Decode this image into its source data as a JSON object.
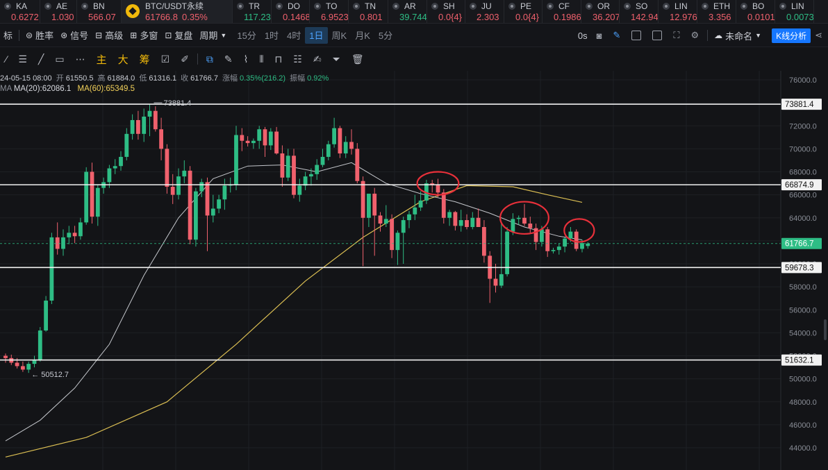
{
  "ticker": [
    {
      "sym": "KA",
      "price": "0.6272",
      "dir": "down"
    },
    {
      "sym": "AE",
      "price": "1.030",
      "dir": "down"
    },
    {
      "sym": "BN",
      "price": "566.07",
      "dir": "down"
    },
    {
      "sym": "BTC/USDT永续",
      "price": "61766.8",
      "change": "0.35%",
      "dir": "down",
      "active": true
    },
    {
      "sym": "TR",
      "price": "117.23",
      "dir": "up"
    },
    {
      "sym": "DO",
      "price": "0.1468",
      "dir": "down"
    },
    {
      "sym": "TO",
      "price": "6.9523",
      "dir": "down"
    },
    {
      "sym": "TN",
      "price": "0.801",
      "dir": "down"
    },
    {
      "sym": "AR",
      "price": "39.744",
      "dir": "up"
    },
    {
      "sym": "SH",
      "price": "0.0{4}",
      "dir": "down"
    },
    {
      "sym": "JU",
      "price": "2.303",
      "dir": "down"
    },
    {
      "sym": "PE",
      "price": "0.0{4}",
      "dir": "down"
    },
    {
      "sym": "CF",
      "price": "0.1986",
      "dir": "down"
    },
    {
      "sym": "OR",
      "price": "36.207",
      "dir": "down"
    },
    {
      "sym": "SO",
      "price": "142.94",
      "dir": "down"
    },
    {
      "sym": "LIN",
      "price": "12.976",
      "dir": "down"
    },
    {
      "sym": "ETH",
      "price": "3.356",
      "dir": "down"
    },
    {
      "sym": "BO",
      "price": "0.0101",
      "dir": "down"
    },
    {
      "sym": "LIN",
      "price": "0.0073",
      "dir": "up"
    }
  ],
  "toolbar1": {
    "left_partial": "标",
    "winrate": "胜率",
    "signal": "信号",
    "advanced": "高级",
    "multiframe": "多窗",
    "replay": "复盘",
    "period": "周期",
    "intervals": [
      "15分",
      "1时",
      "4时",
      "1日",
      "周K",
      "月K",
      "5分"
    ],
    "selected_interval": "1日",
    "delay": "0s",
    "layout_name": "未命名",
    "kline_analysis": "K线分析"
  },
  "toolbar2": {
    "labels": [
      "主",
      "大",
      "筹"
    ]
  },
  "legend": {
    "date": "24-05-15 08:00",
    "open_label": "开",
    "open": "61550.5",
    "high_label": "高",
    "high": "61884.0",
    "low_label": "低",
    "low": "61316.1",
    "close_label": "收",
    "close": "61766.7",
    "chg_label": "涨幅",
    "chg": "0.35%(216.2)",
    "amp_label": "振幅",
    "amp": "0.92%",
    "ma_prefix": "MA",
    "ma20": "MA(20):62086.1",
    "ma60": "MA(60):65349.5"
  },
  "colors": {
    "up": "#2ebd85",
    "down": "#f0616d",
    "ma20": "#d7d9df",
    "ma60": "#f2d15a",
    "bg": "#131417",
    "circle": "#e8303a"
  },
  "chart_data": {
    "type": "candlestick",
    "ylim": [
      43000,
      77000
    ],
    "y_ticks": [
      44000,
      46000,
      48000,
      50000,
      52000,
      54000,
      56000,
      58000,
      60000,
      62000,
      64000,
      66000,
      68000,
      70000,
      72000,
      74000,
      76000
    ],
    "hlines": [
      {
        "value": 73881.4,
        "label": "73881.4"
      },
      {
        "value": 66874.9,
        "label": "66874.9"
      },
      {
        "value": 59678.3,
        "label": "59678.3"
      },
      {
        "value": 51632.1,
        "label": "51632.1"
      }
    ],
    "current_price": {
      "value": 61766.7,
      "label": "61766.7"
    },
    "annotations": [
      {
        "text": "73881.4",
        "kind": "high"
      },
      {
        "text": "50512.7",
        "kind": "low"
      }
    ],
    "candles": [
      [
        52000,
        52200,
        51400,
        51800
      ],
      [
        51800,
        52100,
        51200,
        51400
      ],
      [
        51400,
        51800,
        50900,
        51100
      ],
      [
        51100,
        51500,
        50600,
        50800
      ],
      [
        50800,
        51500,
        50512,
        51300
      ],
      [
        51300,
        52000,
        51000,
        51600
      ],
      [
        51600,
        54500,
        51500,
        54200
      ],
      [
        54200,
        57200,
        54100,
        56800
      ],
      [
        56800,
        62700,
        56500,
        62300
      ],
      [
        62300,
        63600,
        60800,
        61300
      ],
      [
        61300,
        63000,
        60700,
        62300
      ],
      [
        62300,
        63300,
        61700,
        62700
      ],
      [
        62700,
        63300,
        61800,
        62400
      ],
      [
        62400,
        64000,
        62100,
        63600
      ],
      [
        63600,
        68400,
        63400,
        68000
      ],
      [
        68000,
        68800,
        63500,
        64100
      ],
      [
        64100,
        66900,
        63300,
        66600
      ],
      [
        66600,
        67500,
        66100,
        67100
      ],
      [
        67100,
        68600,
        66600,
        68300
      ],
      [
        68300,
        69100,
        67800,
        68500
      ],
      [
        68500,
        69800,
        68100,
        69300
      ],
      [
        69300,
        71800,
        69000,
        71300
      ],
      [
        71300,
        73000,
        70800,
        72500
      ],
      [
        72500,
        73300,
        70800,
        71300
      ],
      [
        71300,
        73500,
        70600,
        72800
      ],
      [
        72800,
        73881,
        71100,
        73300
      ],
      [
        73300,
        73700,
        71500,
        71700
      ],
      [
        71700,
        72700,
        69000,
        70000
      ],
      [
        70000,
        70400,
        66100,
        66700
      ],
      [
        66700,
        67800,
        65200,
        66000
      ],
      [
        66000,
        68300,
        65600,
        67600
      ],
      [
        67600,
        69000,
        67000,
        68100
      ],
      [
        68100,
        68500,
        61700,
        62100
      ],
      [
        62100,
        66600,
        61500,
        66300
      ],
      [
        66300,
        67400,
        65800,
        67100
      ],
      [
        67100,
        67500,
        61100,
        64200
      ],
      [
        64200,
        66000,
        63600,
        64800
      ],
      [
        64800,
        66000,
        64400,
        65600
      ],
      [
        65600,
        67400,
        64700,
        66800
      ],
      [
        66800,
        67500,
        66200,
        66900
      ],
      [
        66900,
        72000,
        66400,
        71200
      ],
      [
        71200,
        71800,
        69800,
        70700
      ],
      [
        70700,
        71100,
        70200,
        70500
      ],
      [
        70500,
        70900,
        70000,
        70700
      ],
      [
        70700,
        72000,
        70000,
        71700
      ],
      [
        71700,
        71900,
        69300,
        70300
      ],
      [
        70300,
        71800,
        69900,
        71500
      ],
      [
        71500,
        71900,
        69500,
        69600
      ],
      [
        69600,
        70300,
        66700,
        67500
      ],
      [
        67500,
        70000,
        67200,
        69400
      ],
      [
        69400,
        70000,
        65700,
        66000
      ],
      [
        66000,
        67400,
        65400,
        66800
      ],
      [
        66800,
        68000,
        66400,
        67600
      ],
      [
        67600,
        68300,
        66800,
        67800
      ],
      [
        67800,
        69100,
        67300,
        68600
      ],
      [
        68600,
        70000,
        68400,
        69300
      ],
      [
        69300,
        70700,
        69000,
        70400
      ],
      [
        70400,
        72700,
        70100,
        71800
      ],
      [
        71800,
        72000,
        69200,
        69600
      ],
      [
        69600,
        71100,
        69200,
        70600
      ],
      [
        70600,
        71700,
        69500,
        70000
      ],
      [
        70000,
        70500,
        67000,
        67200
      ],
      [
        67200,
        67600,
        59800,
        64000
      ],
      [
        64000,
        66000,
        63200,
        66100
      ],
      [
        66100,
        66600,
        60700,
        64200
      ],
      [
        64200,
        64500,
        62800,
        63500
      ],
      [
        63500,
        65100,
        63200,
        63900
      ],
      [
        63900,
        64300,
        60500,
        61200
      ],
      [
        61200,
        62900,
        59900,
        62700
      ],
      [
        62700,
        64100,
        60000,
        63800
      ],
      [
        63800,
        64600,
        63100,
        64300
      ],
      [
        64300,
        66000,
        63800,
        64900
      ],
      [
        64900,
        66300,
        64600,
        65500
      ],
      [
        65500,
        67300,
        65200,
        67000
      ],
      [
        67000,
        67300,
        66200,
        66900
      ],
      [
        66900,
        67400,
        65800,
        66200
      ],
      [
        66200,
        66500,
        63500,
        64000
      ],
      [
        64000,
        64700,
        63300,
        64500
      ],
      [
        64500,
        64600,
        62900,
        63300
      ],
      [
        63300,
        64700,
        62800,
        63800
      ],
      [
        63800,
        64300,
        63000,
        63200
      ],
      [
        63200,
        64500,
        63000,
        64000
      ],
      [
        64000,
        64800,
        63400,
        63200
      ],
      [
        63200,
        63800,
        60100,
        60700
      ],
      [
        60700,
        61100,
        56600,
        58700
      ],
      [
        58700,
        60000,
        57500,
        58100
      ],
      [
        58100,
        63600,
        57900,
        59100
      ],
      [
        59100,
        63200,
        58900,
        62800
      ],
      [
        62800,
        64400,
        62500,
        63900
      ],
      [
        63900,
        64200,
        63400,
        64000
      ],
      [
        64000,
        65200,
        63300,
        63500
      ],
      [
        63500,
        64100,
        62700,
        63100
      ],
      [
        63100,
        63500,
        61200,
        61900
      ],
      [
        61900,
        63300,
        61500,
        63000
      ],
      [
        63000,
        63200,
        60600,
        61100
      ],
      [
        61100,
        61400,
        60900,
        61200
      ],
      [
        61200,
        61800,
        60800,
        61500
      ],
      [
        61500,
        62300,
        61000,
        62200
      ],
      [
        62200,
        63200,
        61900,
        62800
      ],
      [
        62800,
        63000,
        61100,
        61300
      ],
      [
        61300,
        62100,
        61000,
        61800
      ],
      [
        61550,
        61884,
        61316,
        61766
      ]
    ],
    "ma20": [
      [
        0,
        44600
      ],
      [
        6,
        46400
      ],
      [
        12,
        49200
      ],
      [
        18,
        53000
      ],
      [
        24,
        59000
      ],
      [
        30,
        64000
      ],
      [
        36,
        67400
      ],
      [
        42,
        68500
      ],
      [
        48,
        68600
      ],
      [
        54,
        68000
      ],
      [
        60,
        68800
      ],
      [
        66,
        67000
      ],
      [
        72,
        66100
      ],
      [
        78,
        65400
      ],
      [
        84,
        64400
      ],
      [
        90,
        63200
      ],
      [
        96,
        62400
      ],
      [
        100,
        62086
      ]
    ],
    "ma60": [
      [
        0,
        43200
      ],
      [
        14,
        44900
      ],
      [
        28,
        48000
      ],
      [
        40,
        53000
      ],
      [
        52,
        58500
      ],
      [
        62,
        62300
      ],
      [
        72,
        65400
      ],
      [
        80,
        66800
      ],
      [
        88,
        66700
      ],
      [
        94,
        66000
      ],
      [
        100,
        65350
      ]
    ],
    "circles": [
      {
        "cx": 75,
        "cy": 67000,
        "rx": 3.6,
        "ry": 1000
      },
      {
        "cx": 90,
        "cy": 64000,
        "rx": 4.2,
        "ry": 1400
      },
      {
        "cx": 99.5,
        "cy": 62900,
        "rx": 2.6,
        "ry": 1000
      }
    ]
  }
}
